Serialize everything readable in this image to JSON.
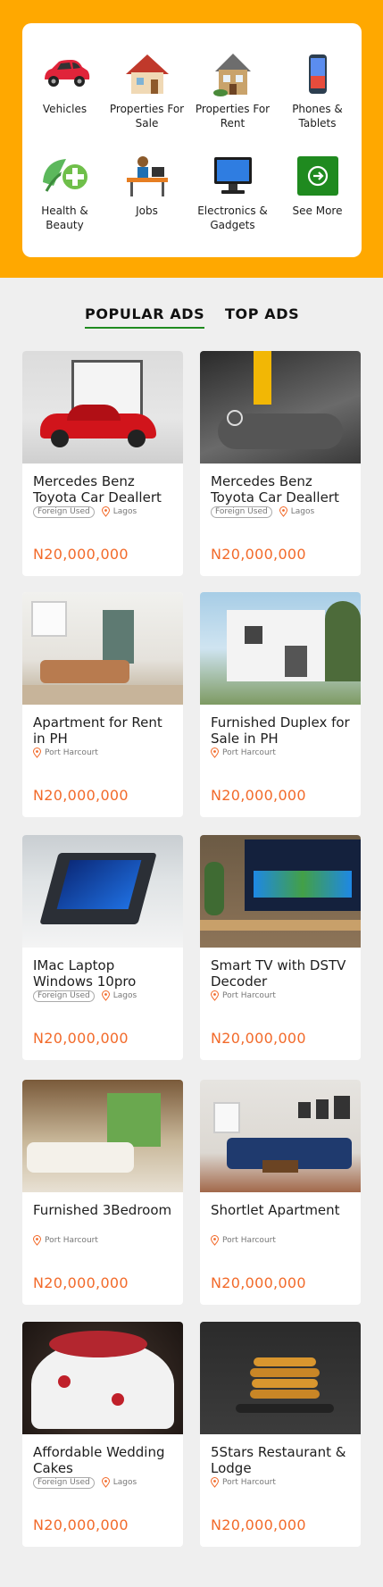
{
  "categories": [
    {
      "label": "Vehicles",
      "icon": "car-icon"
    },
    {
      "label": "Properties For Sale",
      "icon": "house-sale-icon"
    },
    {
      "label": "Properties For Rent",
      "icon": "house-rent-icon"
    },
    {
      "label": "Phones & Tablets",
      "icon": "phone-icon"
    },
    {
      "label": "Health & Beauty",
      "icon": "health-icon"
    },
    {
      "label": "Jobs",
      "icon": "jobs-icon"
    },
    {
      "label": "Electronics & Gadgets",
      "icon": "monitor-icon"
    },
    {
      "label": "See More",
      "icon": "arrow-right-circle-icon"
    }
  ],
  "tabs": {
    "popular": "POPULAR ADS",
    "top": "TOP ADS"
  },
  "ads": [
    {
      "title": "Mercedes Benz Toyota Car Deallert",
      "badge": "Foreign Used",
      "location": "Lagos",
      "price": "N20,000,000"
    },
    {
      "title": "Mercedes Benz Toyota Car Deallert",
      "badge": "Foreign Used",
      "location": "Lagos",
      "price": "N20,000,000"
    },
    {
      "title": "Apartment for Rent in PH",
      "badge": "",
      "location": "Port Harcourt",
      "price": "N20,000,000"
    },
    {
      "title": "Furnished Duplex for Sale in PH",
      "badge": "",
      "location": "Port Harcourt",
      "price": "N20,000,000"
    },
    {
      "title": "IMac Laptop Windows 10pro",
      "badge": "Foreign Used",
      "location": "Lagos",
      "price": "N20,000,000"
    },
    {
      "title": "Smart TV with DSTV Decoder",
      "badge": "",
      "location": "Port Harcourt",
      "price": "N20,000,000"
    },
    {
      "title": "Furnished 3Bedroom",
      "badge": "",
      "location": "Port Harcourt",
      "price": "N20,000,000"
    },
    {
      "title": "Shortlet Apartment",
      "badge": "",
      "location": "Port Harcourt",
      "price": "N20,000,000"
    },
    {
      "title": "Affordable Wedding Cakes",
      "badge": "Foreign Used",
      "location": "Lagos",
      "price": "N20,000,000"
    },
    {
      "title": "5Stars Restaurant & Lodge",
      "badge": "",
      "location": "Port Harcourt",
      "price": "N20,000,000"
    }
  ],
  "colors": {
    "accent": "#ffa800",
    "price": "#f26a2a",
    "tab_underline": "#1f8a1f",
    "see_more": "#1f8a1f"
  }
}
